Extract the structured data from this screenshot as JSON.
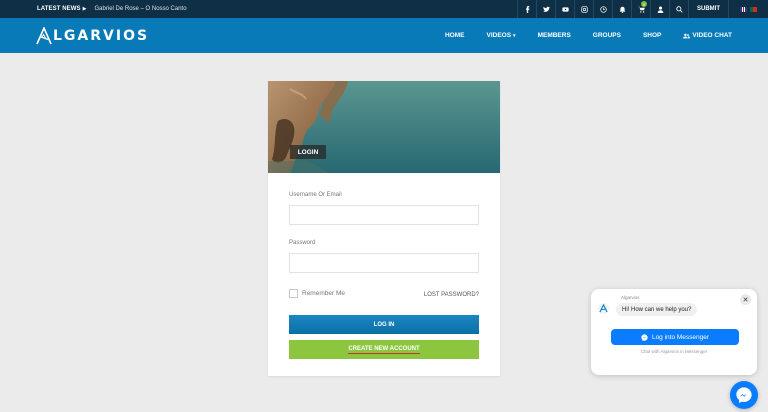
{
  "topbar": {
    "latest_label": "LATEST NEWS",
    "news_title": "Gabriel De Rose – O Nosso Canto",
    "icons": [
      "facebook-icon",
      "twitter-icon",
      "youtube-icon",
      "instagram-icon",
      "clock-icon",
      "bell-icon",
      "cart-icon",
      "user-icon",
      "search-icon"
    ],
    "cart_count": "0",
    "submit_label": "SUBMIT",
    "languages": [
      "en",
      "pt"
    ]
  },
  "nav": {
    "logo_text": "LGARVIOS",
    "items": [
      "HOME",
      "VIDEOS",
      "MEMBERS",
      "GROUPS",
      "SHOP",
      "VIDEO CHAT"
    ]
  },
  "login": {
    "hero_label": "LOGIN",
    "username_label": "Username Or Email",
    "password_label": "Password",
    "remember_label": "Remember Me",
    "lost_password": "LOST PASSWORD?",
    "login_button": "LOG IN",
    "create_button": "CREATE NEW ACCOUNT"
  },
  "messenger": {
    "page_name": "Algarvios",
    "greeting": "Hi! How can we help you?",
    "button": "Log into Messenger",
    "note": "Chat with Algarvios in Messenger",
    "close": "✕"
  },
  "colors": {
    "topbar": "#0e2f45",
    "navbar": "#087ab7",
    "login_button": "#0a6fa6",
    "create_button": "#8cc63f",
    "messenger": "#0a7cff"
  }
}
